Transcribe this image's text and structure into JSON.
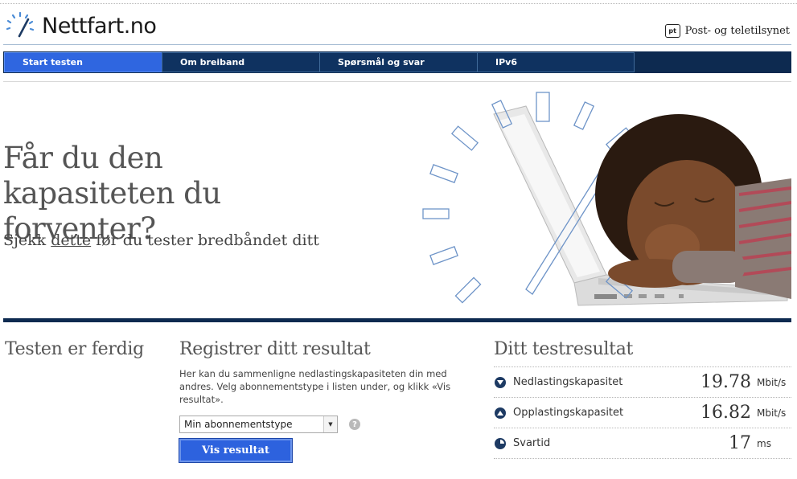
{
  "header": {
    "logo_text": "Nettfart.no",
    "partner_badge": "pt",
    "partner_text": "Post- og teletilsynet"
  },
  "nav": {
    "items": [
      {
        "label": "Start testen",
        "active": true
      },
      {
        "label": "Om breiband",
        "active": false
      },
      {
        "label": "Spørsmål og svar",
        "active": false
      },
      {
        "label": "IPv6",
        "active": false
      }
    ]
  },
  "hero": {
    "title": "Får du den kapasiteten du forventer?",
    "subtitle_prefix": "Sjekk",
    "subtitle_link": "dette",
    "subtitle_suffix": "før du tester bredbåndet ditt"
  },
  "status": {
    "title": "Testen er ferdig"
  },
  "register": {
    "title": "Registrer ditt resultat",
    "description": "Her kan du sammenligne nedlastingskapasiteten din med andres. Velg abonnementstype i listen under, og klikk «Vis resultat».",
    "select_value": "Min abonnementstype",
    "help_icon": "?",
    "button_label": "Vis resultat"
  },
  "results": {
    "title": "Ditt testresultat",
    "rows": [
      {
        "icon": "download-icon",
        "label": "Nedlastingskapasitet",
        "value": "19.78",
        "unit": "Mbit/s"
      },
      {
        "icon": "upload-icon",
        "label": "Opplastingskapasitet",
        "value": "16.82",
        "unit": "Mbit/s"
      },
      {
        "icon": "clock-icon",
        "label": "Svartid",
        "value": "17",
        "unit": "ms"
      }
    ]
  },
  "colors": {
    "nav_background": "#0d2a50",
    "nav_active": "#2f66e0",
    "button": "#2d62de"
  }
}
